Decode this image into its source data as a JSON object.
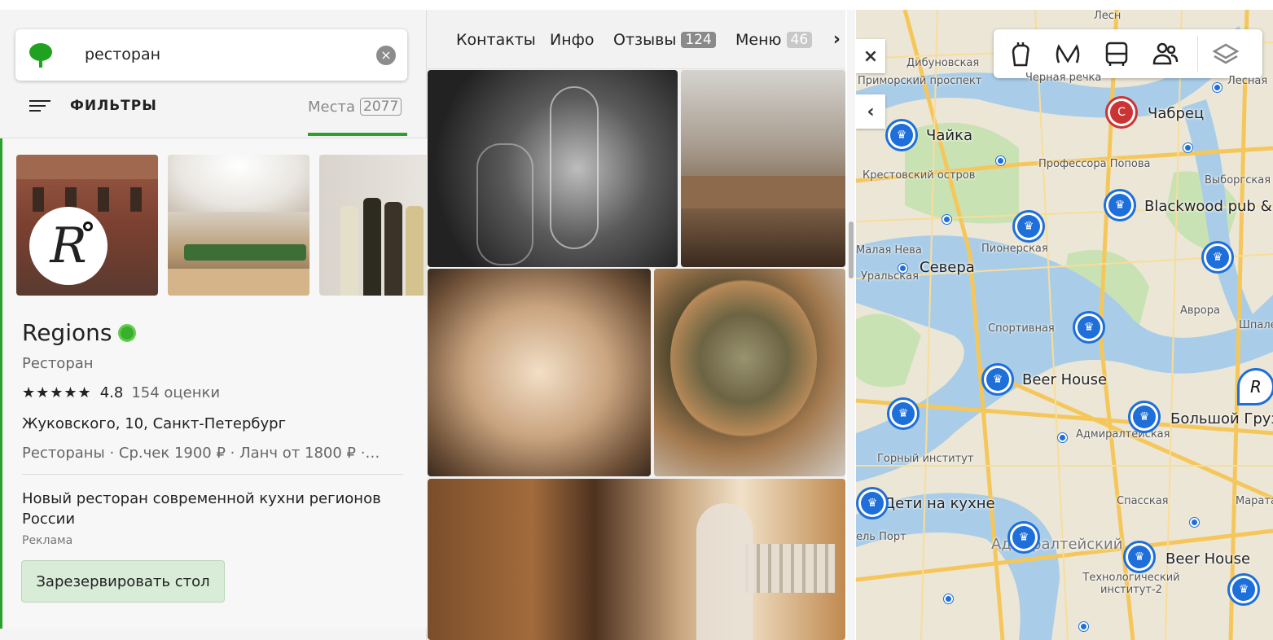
{
  "search": {
    "query": "ресторан",
    "clear_icon": "×"
  },
  "filters": {
    "label": "ФИЛЬТРЫ"
  },
  "places": {
    "label": "Места",
    "count": "2077"
  },
  "card": {
    "name": "Regions",
    "category": "Ресторан",
    "stars": "★★★★★",
    "rating": "4.8",
    "rating_count": "154 оценки",
    "address": "Жуковского, 10, Санкт-Петербург",
    "meta": "Рестораны · Ср.чек 1900 ₽ · Ланч от 1800 ₽ ·…",
    "promo": "Новый ресторан современной кухни регионов России",
    "ad_label": "Реклама",
    "reserve_label": "Зарезервировать стол"
  },
  "tabs": [
    {
      "label": "Контакты"
    },
    {
      "label": "Инфо"
    },
    {
      "label": "Отзывы",
      "badge": "124"
    },
    {
      "label": "Меню",
      "badge": "46"
    }
  ],
  "map": {
    "close_icon": "×",
    "back_icon": "‹",
    "labels": {
      "chaika": "Чайка",
      "chabrets": "Чабрец",
      "blackwood": "Blackwood pub &",
      "severa": "Севера",
      "beer_house_1": "Beer House",
      "bolshoy": "Большой Груз",
      "deti": "Дети на кухне",
      "beer_house_2": "Beer House"
    },
    "small_labels": {
      "dibunovskaya": "Дибуновская",
      "primorsky": "Приморский проспект",
      "chernaya": "Черная речка",
      "krestovsky": "Крестовский остров",
      "professora": "Профессора Попова",
      "vyborgskaya": "Выборгская",
      "pionerskaya": "Пионерская",
      "neva": "Малая Нева",
      "uralskaya": "Уральская",
      "sportivnaya": "Спортивная",
      "avrora": "Аврора",
      "shpalernaya": "Шпалер",
      "admiralteyskaya": "Адмиралтейская",
      "gorny": "Горный институт",
      "spasskaya": "Спасская",
      "admiralteysky": "Адмиралтейский",
      "tekhnologichesky": "Технологический институт-2",
      "port": "ель Порт",
      "marata": "Марата",
      "lesnaya": "Лесн",
      "lesnaya2": "Лесная"
    }
  }
}
